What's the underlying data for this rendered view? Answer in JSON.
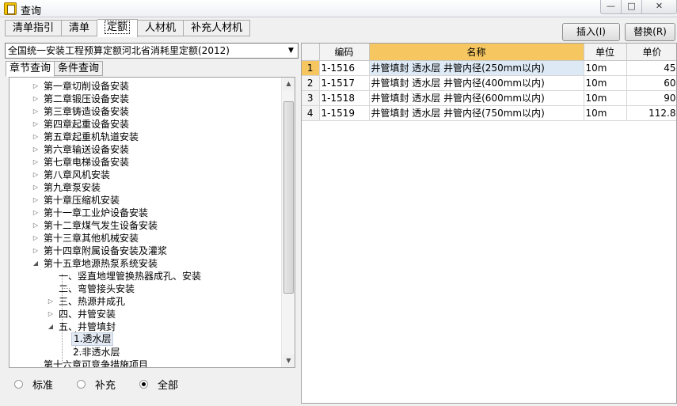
{
  "window": {
    "title": "查询"
  },
  "tabs": [
    {
      "label": "清单指引"
    },
    {
      "label": "清单"
    },
    {
      "label": "定额"
    },
    {
      "label": "人材机"
    },
    {
      "label": "补充人材机"
    }
  ],
  "buttons": {
    "insert": "插入(I)",
    "replace": "替换(R)"
  },
  "library_select": {
    "value": "全国统一安装工程预算定额河北省消耗里定额(2012)"
  },
  "subtabs": [
    {
      "label": "章节查询"
    },
    {
      "label": "条件查询"
    }
  ],
  "tree": [
    {
      "label": "第一章切削设备安装"
    },
    {
      "label": "第二章锻压设备安装"
    },
    {
      "label": "第三章铸造设备安装"
    },
    {
      "label": "第四章起重设备安装"
    },
    {
      "label": "第五章起重机轨道安装"
    },
    {
      "label": "第六章输送设备安装"
    },
    {
      "label": "第七章电梯设备安装"
    },
    {
      "label": "第八章风机安装"
    },
    {
      "label": "第九章泵安装"
    },
    {
      "label": "第十章压缩机安装"
    },
    {
      "label": "第十一章工业炉设备安装"
    },
    {
      "label": "第十二章煤气发生设备安装"
    },
    {
      "label": "第十三章其他机械安装"
    },
    {
      "label": "第十四章附属设备安装及灌浆"
    },
    {
      "label": "第十五章地源热泵系统安装"
    },
    {
      "label": "一、竖直地埋管换热器成孔、安装"
    },
    {
      "label": "二、弯管接头安装"
    },
    {
      "label": "三、热源井成孔"
    },
    {
      "label": "四、井管安装"
    },
    {
      "label": "五、井管填封"
    },
    {
      "label": "1.透水层"
    },
    {
      "label": "2.非透水层"
    },
    {
      "label": "第十六章可竞争措施项目"
    }
  ],
  "radios": [
    {
      "label": "标准",
      "checked": false
    },
    {
      "label": "补充",
      "checked": false
    },
    {
      "label": "全部",
      "checked": true
    }
  ],
  "grid": {
    "columns": [
      "编码",
      "名称",
      "单位",
      "单价"
    ],
    "rows": [
      {
        "num": "1",
        "code": "1-1516",
        "name": "井管填封 透水层 井管内径(250mm以内)",
        "unit": "10m",
        "price": "45"
      },
      {
        "num": "2",
        "code": "1-1517",
        "name": "井管填封 透水层 井管内径(400mm以内)",
        "unit": "10m",
        "price": "60"
      },
      {
        "num": "3",
        "code": "1-1518",
        "name": "井管填封 透水层 井管内径(600mm以内)",
        "unit": "10m",
        "price": "90"
      },
      {
        "num": "4",
        "code": "1-1519",
        "name": "井管填封 透水层 井管内径(750mm以内)",
        "unit": "10m",
        "price": "112.8"
      }
    ]
  }
}
